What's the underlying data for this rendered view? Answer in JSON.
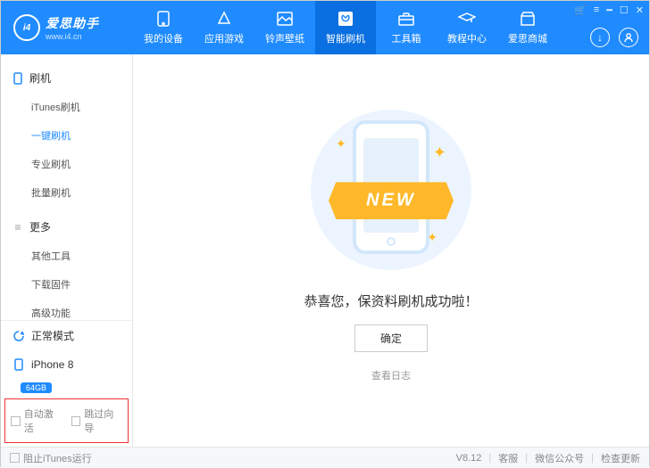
{
  "brand": {
    "title": "爱思助手",
    "subtitle": "www.i4.cn",
    "logo_text": "i4"
  },
  "nav": [
    {
      "label": "我的设备"
    },
    {
      "label": "应用游戏"
    },
    {
      "label": "铃声壁纸"
    },
    {
      "label": "智能刷机",
      "active": true
    },
    {
      "label": "工具箱"
    },
    {
      "label": "教程中心"
    },
    {
      "label": "爱思商城"
    }
  ],
  "sidebar": {
    "groups": [
      {
        "title": "刷机",
        "items": [
          {
            "label": "iTunes刷机"
          },
          {
            "label": "一键刷机",
            "active": true
          },
          {
            "label": "专业刷机"
          },
          {
            "label": "批量刷机"
          }
        ]
      },
      {
        "title": "更多",
        "items": [
          {
            "label": "其他工具"
          },
          {
            "label": "下载固件"
          },
          {
            "label": "高级功能"
          }
        ]
      }
    ],
    "mode": "正常模式",
    "device": {
      "name": "iPhone 8",
      "storage": "64GB"
    },
    "options": {
      "auto_activate": "自动激活",
      "skip_wizard": "跳过向导"
    }
  },
  "main": {
    "banner_text": "NEW",
    "message": "恭喜您，保资料刷机成功啦！",
    "confirm_label": "确定",
    "log_label": "查看日志"
  },
  "footer": {
    "block_itunes": "阻止iTunes运行",
    "version": "V8.12",
    "support": "客服",
    "wechat": "微信公众号",
    "update": "检查更新"
  }
}
